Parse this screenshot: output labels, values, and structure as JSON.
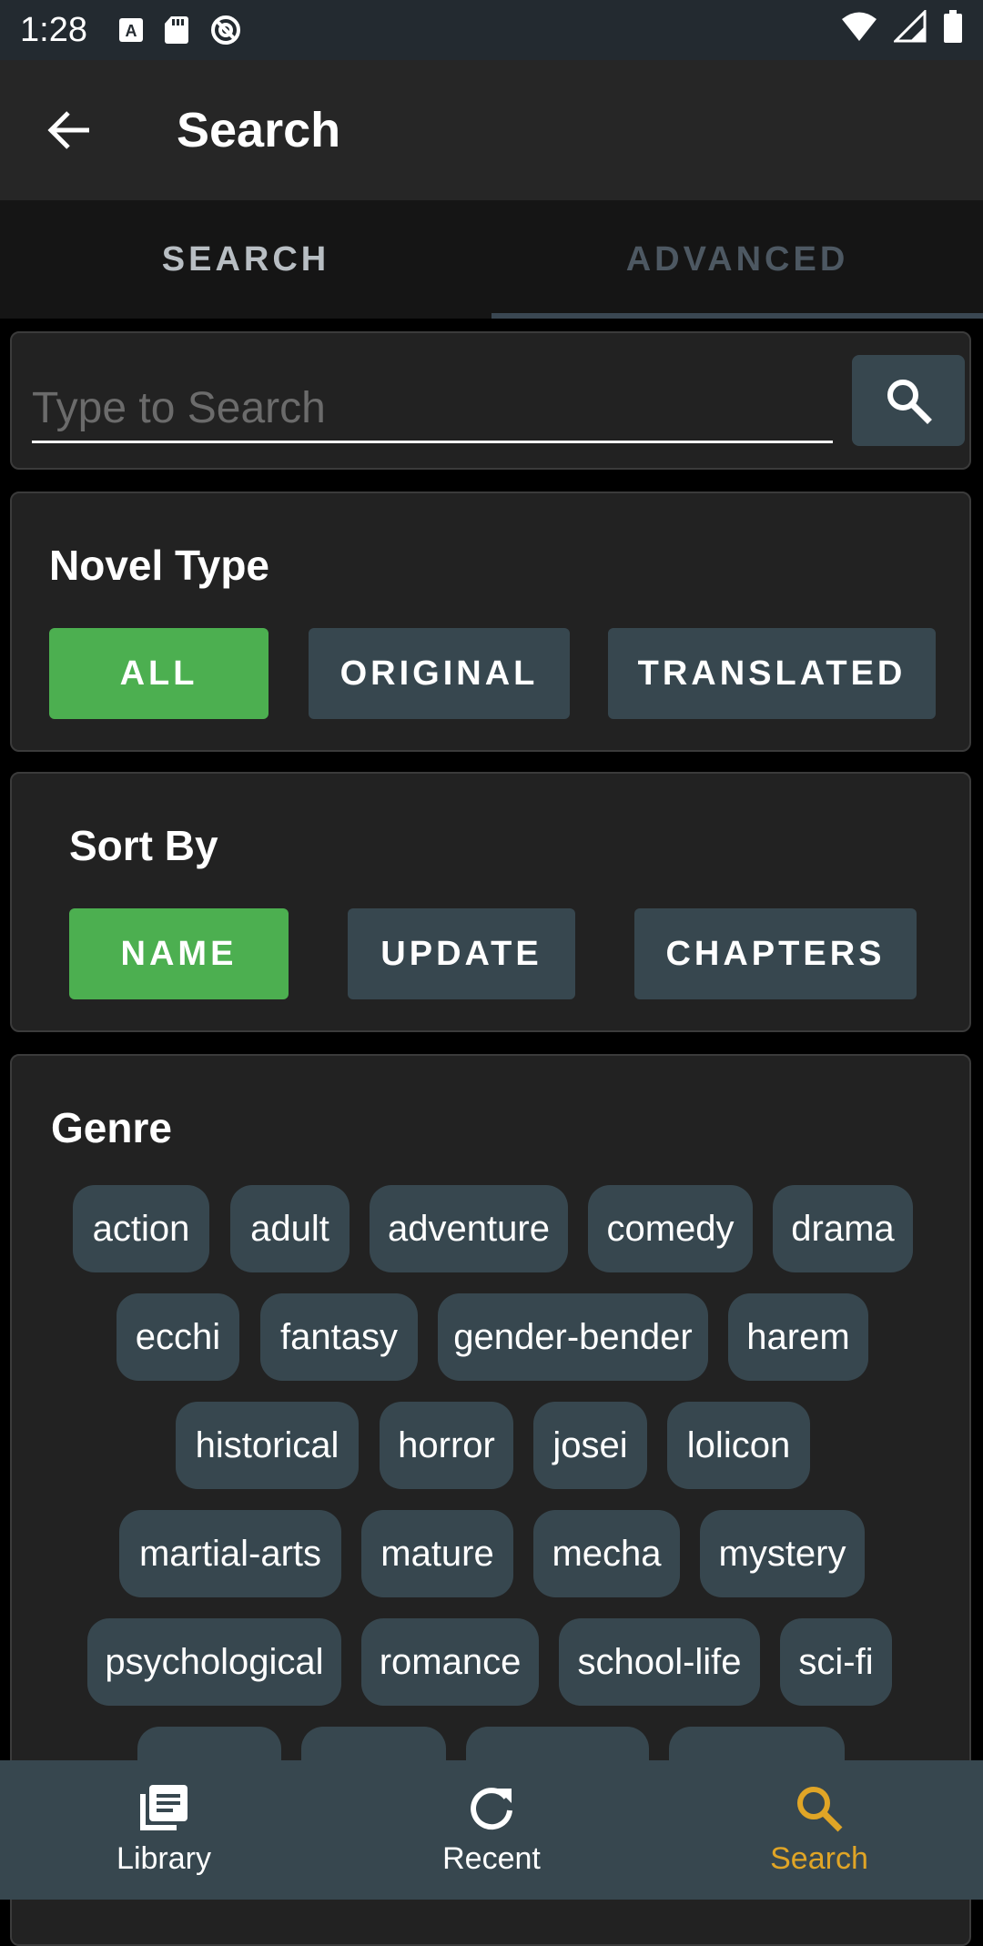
{
  "status_bar": {
    "time": "1:28"
  },
  "app_bar": {
    "title": "Search"
  },
  "tabs": [
    {
      "label": "SEARCH"
    },
    {
      "label": "ADVANCED"
    }
  ],
  "search": {
    "placeholder": "Type to Search",
    "value": ""
  },
  "novel_type": {
    "title": "Novel Type",
    "options": [
      "ALL",
      "ORIGINAL",
      "TRANSLATED"
    ],
    "selected": "ALL"
  },
  "sort_by": {
    "title": "Sort By",
    "options": [
      "NAME",
      "UPDATE",
      "CHAPTERS"
    ],
    "selected": "NAME"
  },
  "genre": {
    "title": "Genre",
    "chips": [
      "action",
      "adult",
      "adventure",
      "comedy",
      "drama",
      "ecchi",
      "fantasy",
      "gender-bender",
      "harem",
      "historical",
      "horror",
      "josei",
      "lolicon",
      "martial-arts",
      "mature",
      "mecha",
      "mystery",
      "psychological",
      "romance",
      "school-life",
      "sci-fi"
    ]
  },
  "bottom_nav": [
    {
      "label": "Library",
      "icon": "library-icon"
    },
    {
      "label": "Recent",
      "icon": "refresh-icon"
    },
    {
      "label": "Search",
      "icon": "search-icon",
      "active": true
    }
  ],
  "colors": {
    "accent_green": "#4caf50",
    "button_slate": "#37474f",
    "nav_active": "#e0a526"
  }
}
